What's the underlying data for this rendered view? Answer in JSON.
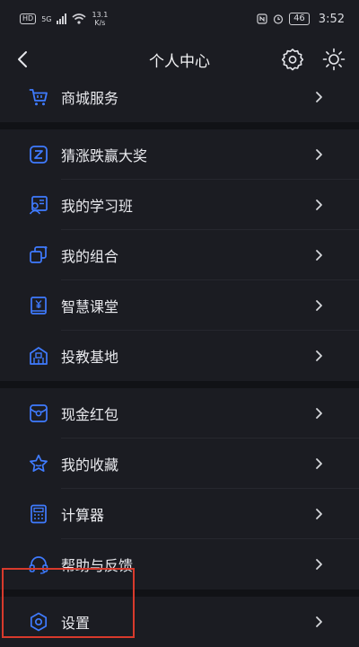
{
  "status_bar": {
    "left": {
      "hd": "HD",
      "net": "5G",
      "speed_value": "13.1",
      "speed_unit": "K/s"
    },
    "right": {
      "battery": "46",
      "time": "3:52"
    }
  },
  "header": {
    "title": "个人中心"
  },
  "colors": {
    "accent": "#3f7bff",
    "background": "#1b1c22",
    "highlight": "#d83a2c"
  },
  "sections": [
    {
      "items": [
        {
          "label": "商城服务",
          "icon": "cart-icon"
        }
      ]
    },
    {
      "items": [
        {
          "label": "猜涨跌赢大奖",
          "icon": "z-badge-icon"
        },
        {
          "label": "我的学习班",
          "icon": "study-class-icon"
        },
        {
          "label": "我的组合",
          "icon": "portfolio-icon"
        },
        {
          "label": "智慧课堂",
          "icon": "book-yen-icon"
        },
        {
          "label": "投教基地",
          "icon": "building-icon"
        }
      ]
    },
    {
      "items": [
        {
          "label": "现金红包",
          "icon": "red-packet-icon"
        },
        {
          "label": "我的收藏",
          "icon": "star-icon"
        },
        {
          "label": "计算器",
          "icon": "calculator-icon"
        },
        {
          "label": "帮助与反馈",
          "icon": "headset-icon"
        }
      ]
    },
    {
      "items": [
        {
          "label": "设置",
          "icon": "settings-icon"
        }
      ]
    }
  ]
}
